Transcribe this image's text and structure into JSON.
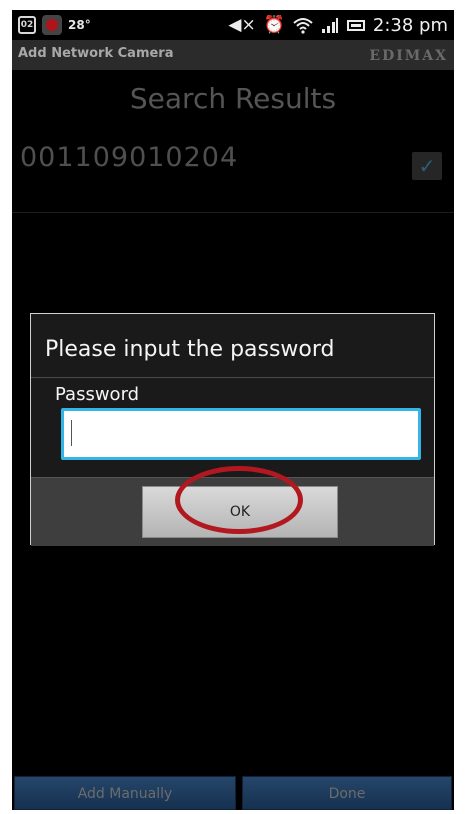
{
  "status_bar": {
    "calendar_date": "02",
    "temperature": "28°",
    "time": "2:38 pm",
    "icons": [
      "calendar-icon",
      "weather-app-icon",
      "mute-icon",
      "alarm-icon",
      "wifi-icon",
      "signal-icon",
      "battery-icon"
    ]
  },
  "app_bar": {
    "title": "Add Network Camera",
    "brand": "EDIMAX"
  },
  "main": {
    "heading": "Search Results",
    "results": [
      {
        "name": "001109010204",
        "checked": true
      }
    ]
  },
  "dialog": {
    "title": "Please input the password",
    "field_label": "Password",
    "password_value": "",
    "ok_label": "OK"
  },
  "bottom": {
    "add_manually_label": "Add Manually",
    "done_label": "Done"
  },
  "colors": {
    "accent": "#33b5e5",
    "highlight": "#b2181f",
    "bottom_button": "#1d3b5e"
  }
}
